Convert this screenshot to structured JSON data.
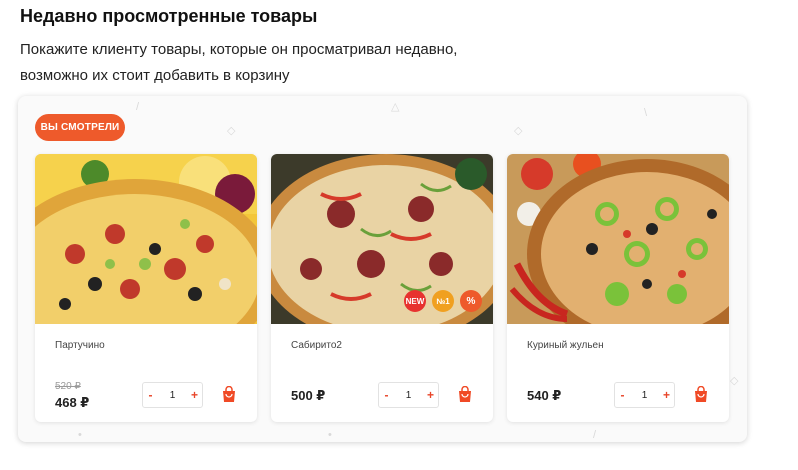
{
  "section": {
    "title": "Недавно просмотренные товары",
    "description_line1": "Покажите клиенту товары, которые он просматривал недавно,",
    "description_line2": "возможно их стоит добавить в корзину"
  },
  "widget": {
    "badge": "ВЫ СМОТРЕЛИ",
    "accent_color": "#ee5a2b",
    "products": [
      {
        "name": "Партучино",
        "old_price": "520 ₽",
        "price": "468 ₽",
        "quantity": "1",
        "minus": "-",
        "plus": "+"
      },
      {
        "name": "Сабирито2",
        "price": "500 ₽",
        "quantity": "1",
        "minus": "-",
        "plus": "+",
        "labels": [
          {
            "text": "NEW",
            "color": "#e7322f"
          },
          {
            "text": "№1",
            "color": "#f0a020"
          },
          {
            "text": "%",
            "color": "#ee5a2b"
          }
        ]
      },
      {
        "name": "Куриный жульен",
        "price": "540 ₽",
        "quantity": "1",
        "minus": "-",
        "plus": "+"
      }
    ]
  }
}
